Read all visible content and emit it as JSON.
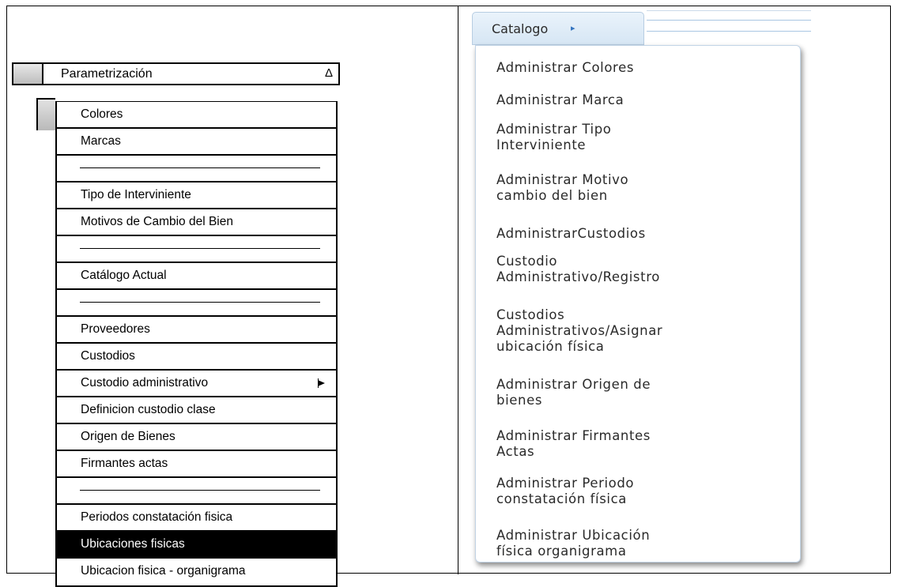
{
  "left_menu": {
    "title": "Parametrización",
    "collapse_icon": "Δ",
    "items": [
      {
        "label": "Colores"
      },
      {
        "label": "Marcas"
      },
      {
        "separator": true
      },
      {
        "label": "Tipo de Interviniente"
      },
      {
        "label": "Motivos de Cambio del Bien"
      },
      {
        "separator": true
      },
      {
        "label": "Catálogo Actual"
      },
      {
        "separator": true
      },
      {
        "label": "Proveedores"
      },
      {
        "label": "Custodios"
      },
      {
        "label": "Custodio administrativo",
        "submenu": true
      },
      {
        "label": "Definicion custodio clase"
      },
      {
        "label": "Origen de Bienes"
      },
      {
        "label": "Firmantes actas"
      },
      {
        "separator": true
      },
      {
        "label": "Periodos constatación fisica"
      },
      {
        "label": "Ubicaciones fisicas",
        "selected": true
      },
      {
        "label": "Ubicacion fisica - organigrama"
      }
    ]
  },
  "right_menu": {
    "tab_label": "Catalogo",
    "tab_icon": "▸",
    "items": [
      {
        "line1": "Administrar Colores"
      },
      {
        "line1": "Administrar Marca"
      },
      {
        "line1": "Administrar Tipo",
        "line2": "Interviniente"
      },
      {
        "line1": "Administrar Motivo",
        "line2": "cambio del bien"
      },
      {
        "line1": "AdministrarCustodios"
      },
      {
        "line1": "Custodio",
        "line2": "Administrativo/Registro"
      },
      {
        "line1": "Custodios",
        "line2": "Administrativos/Asignar",
        "line3": "ubicación física"
      },
      {
        "line1": "Administrar Origen de",
        "line2": "bienes"
      },
      {
        "line1": "Administrar Firmantes",
        "line2": "Actas"
      },
      {
        "line1": "Administrar Periodo",
        "line2": "constatación física"
      },
      {
        "line1": "Administrar Ubicación",
        "line2": "física organigrama"
      }
    ]
  }
}
